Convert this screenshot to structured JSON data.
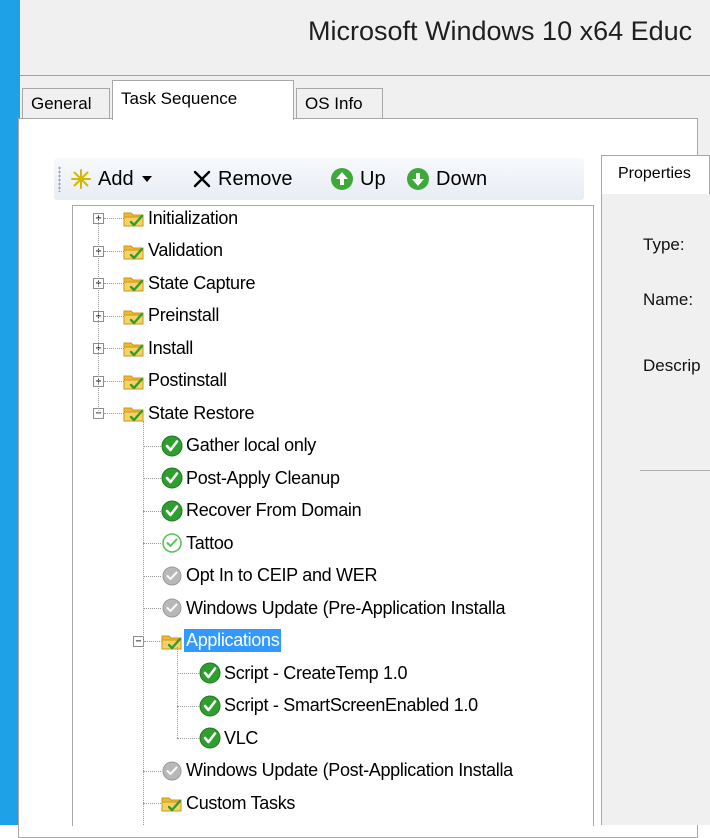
{
  "window": {
    "title": "Microsoft Windows 10 x64 Educ"
  },
  "tabs": [
    {
      "label": "General"
    },
    {
      "label": "Task Sequence",
      "active": true
    },
    {
      "label": "OS Info"
    }
  ],
  "toolbar": {
    "add_label": "Add",
    "remove_label": "Remove",
    "up_label": "Up",
    "down_label": "Down"
  },
  "tree": {
    "top_groups": [
      {
        "label": "Initialization",
        "expanded": false
      },
      {
        "label": "Validation",
        "expanded": false
      },
      {
        "label": "State Capture",
        "expanded": false
      },
      {
        "label": "Preinstall",
        "expanded": false
      },
      {
        "label": "Install",
        "expanded": false
      },
      {
        "label": "Postinstall",
        "expanded": false
      },
      {
        "label": "State Restore",
        "expanded": true
      }
    ],
    "state_restore_children": [
      {
        "label": "Gather local only",
        "icon": "green-check-icon"
      },
      {
        "label": "Post-Apply Cleanup",
        "icon": "green-check-icon"
      },
      {
        "label": "Recover From Domain",
        "icon": "green-check-icon"
      },
      {
        "label": "Tattoo",
        "icon": "light-check-icon"
      },
      {
        "label": "Opt In to CEIP and WER",
        "icon": "disabled-check-icon"
      },
      {
        "label": "Windows Update (Pre-Application Installa",
        "icon": "disabled-check-icon"
      },
      {
        "label": "Applications",
        "icon": "folder-icon",
        "selected": true,
        "expanded": true
      },
      {
        "label": "Windows Update (Post-Application Installa",
        "icon": "disabled-check-icon"
      },
      {
        "label": "Custom Tasks",
        "icon": "folder-icon"
      }
    ],
    "applications_children": [
      {
        "label": "Script - CreateTemp 1.0",
        "icon": "green-check-icon"
      },
      {
        "label": "Script - SmartScreenEnabled 1.0",
        "icon": "green-check-icon"
      },
      {
        "label": "VLC",
        "icon": "green-check-icon"
      }
    ]
  },
  "properties": {
    "tab_label": "Properties",
    "type_label": "Type:",
    "name_label": "Name:",
    "description_label": "Descrip"
  },
  "colors": {
    "selection": "#3399ff",
    "window_border": "#1ea1e6",
    "check_green": "#2e9e2e",
    "folder_yellow": "#f5c542"
  }
}
